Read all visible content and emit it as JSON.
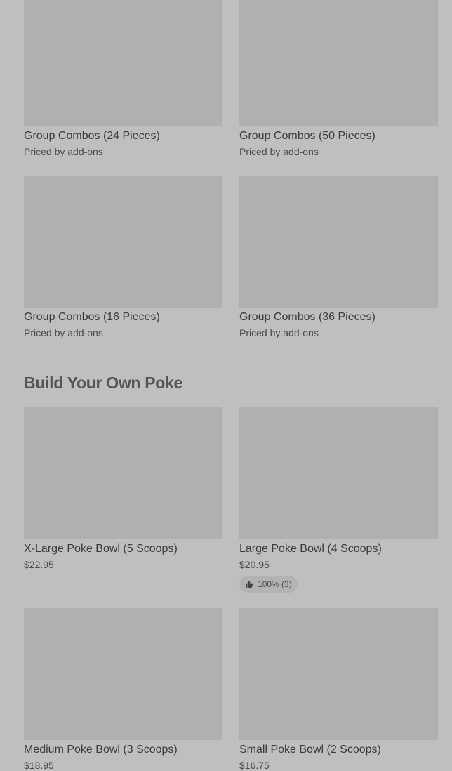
{
  "group_combos": [
    {
      "name": "Group Combos (24 Pieces)",
      "price": "Priced by add-ons"
    },
    {
      "name": "Group Combos (50 Pieces)",
      "price": "Priced by add-ons"
    },
    {
      "name": "Group Combos (16 Pieces)",
      "price": "Priced by add-ons"
    },
    {
      "name": "Group Combos (36 Pieces)",
      "price": "Priced by add-ons"
    }
  ],
  "build_section": {
    "title": "Build Your Own Poke",
    "items": [
      {
        "name": "X-Large Poke Bowl (5 Scoops)",
        "price": "$22.95"
      },
      {
        "name": "Large Poke Bowl (4 Scoops)",
        "price": "$20.95",
        "rating": "100% (3)",
        "rating_icon": "thumbs-up-icon"
      },
      {
        "name": "Medium Poke Bowl (3 Scoops)",
        "price": "$18.95"
      },
      {
        "name": "Small Poke Bowl (2 Scoops)",
        "price": "$16.75"
      }
    ]
  }
}
